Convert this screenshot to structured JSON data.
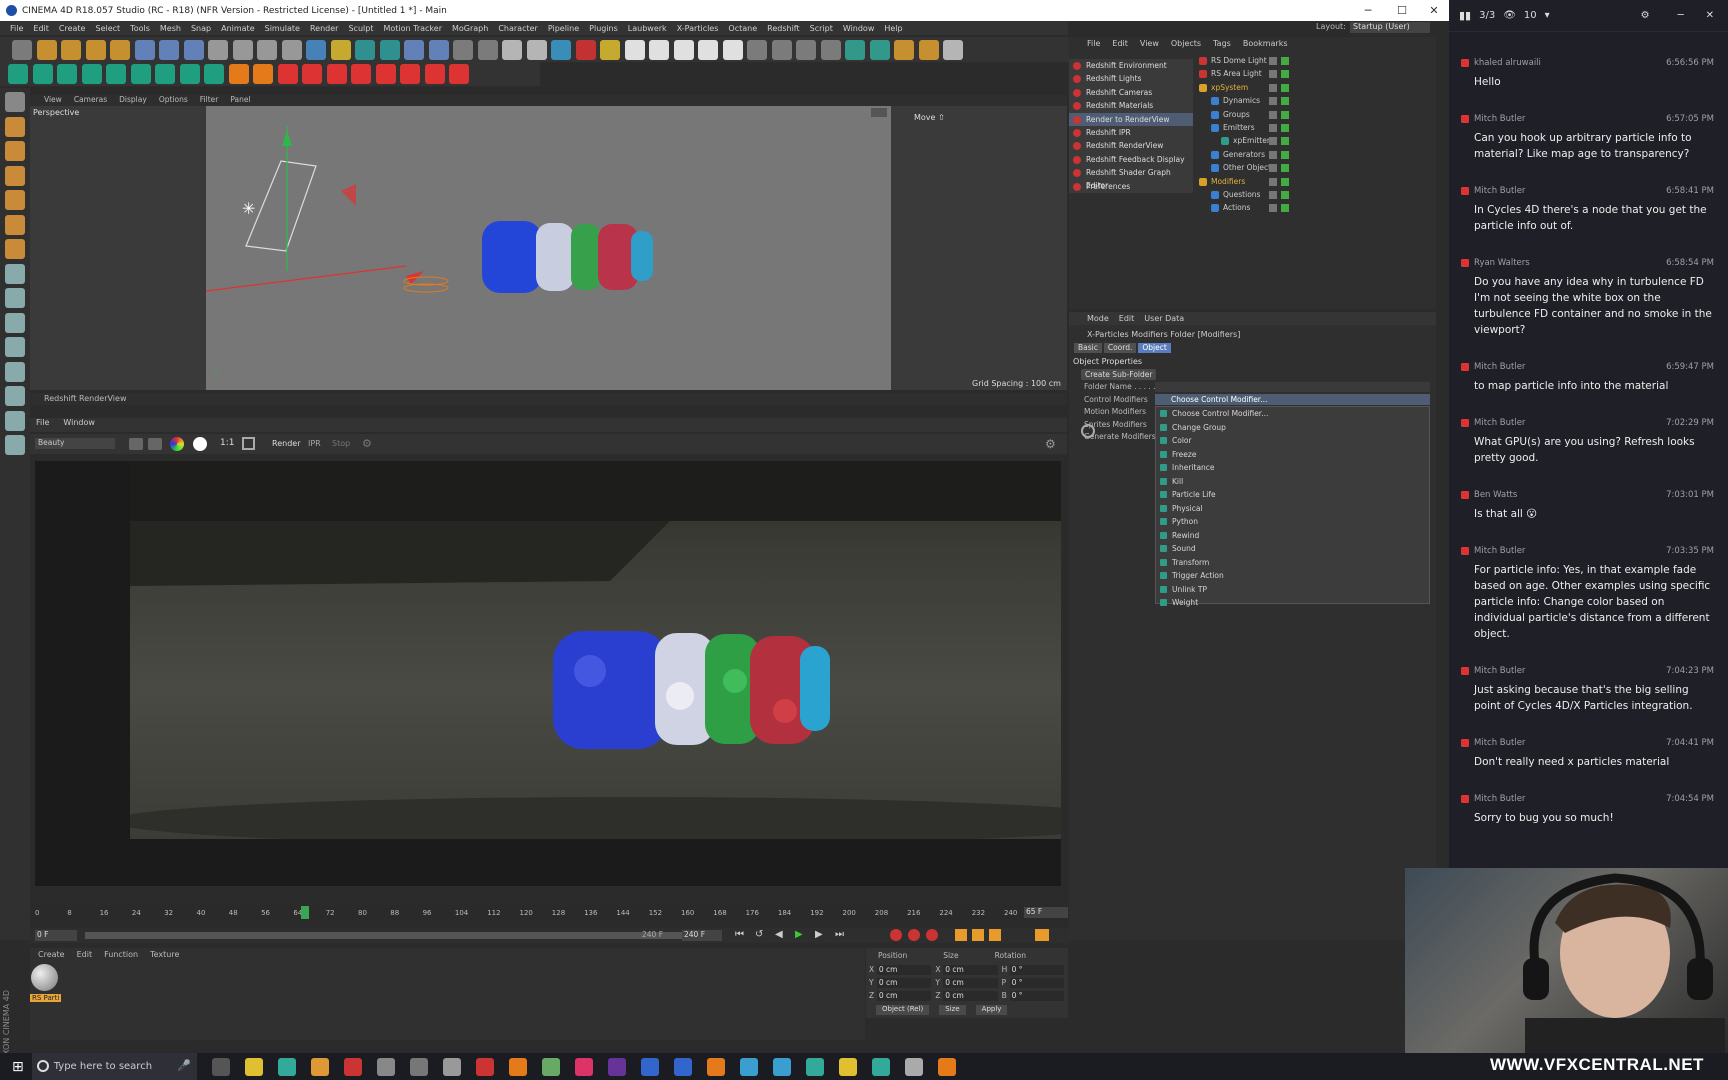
{
  "window": {
    "title": "CINEMA 4D R18.057 Studio (RC - R18) (NFR Version - Restricted License) - [Untitled 1 *] - Main"
  },
  "menubar": [
    "File",
    "Edit",
    "Create",
    "Select",
    "Tools",
    "Mesh",
    "Snap",
    "Animate",
    "Simulate",
    "Render",
    "Sculpt",
    "Motion Tracker",
    "MoGraph",
    "Character",
    "Pipeline",
    "Plugins",
    "Laubwerk",
    "X-Particles",
    "Octane",
    "Redshift",
    "Script",
    "Window",
    "Help"
  ],
  "layout": {
    "label": "Layout:",
    "value": "Startup (User)"
  },
  "viewport": {
    "menu": [
      "View",
      "Cameras",
      "Display",
      "Options",
      "Filter",
      "Panel"
    ],
    "name": "Perspective",
    "move_label": "Move ⇧",
    "grid_spacing": "Grid Spacing : 100 cm"
  },
  "renderview": {
    "title": "Redshift RenderView",
    "menu": [
      "File",
      "Window"
    ],
    "aov": "Beauty",
    "ratio": "1:1",
    "render": "Render",
    "ipr": "IPR",
    "stop": "Stop"
  },
  "timeline": {
    "ticks": [
      "0",
      "8",
      "16",
      "24",
      "32",
      "40",
      "48",
      "56",
      "64",
      "72",
      "80",
      "88",
      "96",
      "104",
      "112",
      "120",
      "128",
      "136",
      "144",
      "152",
      "160",
      "168",
      "176",
      "184",
      "192",
      "200",
      "208",
      "216",
      "224",
      "232",
      "240"
    ],
    "current": "65 F",
    "start": "0 F",
    "end": "240 F",
    "end2": "240 F"
  },
  "material": {
    "menu": [
      "Create",
      "Edit",
      "Function",
      "Texture"
    ],
    "item": "RS Parti"
  },
  "coords": {
    "headers": [
      "Position",
      "Size",
      "Rotation"
    ],
    "rows": [
      [
        "X",
        "0 cm",
        "X",
        "0 cm",
        "H",
        "0 °"
      ],
      [
        "Y",
        "0 cm",
        "Y",
        "0 cm",
        "P",
        "0 °"
      ],
      [
        "Z",
        "0 cm",
        "Z",
        "0 cm",
        "B",
        "0 °"
      ]
    ],
    "mode": "Object (Rel)",
    "size_mode": "Size",
    "apply": "Apply"
  },
  "right_menu": [
    "File",
    "Edit",
    "View",
    "Objects",
    "Tags",
    "Bookmarks"
  ],
  "redshift_menu": [
    "Redshift Environment",
    "Redshift Lights",
    "Redshift Cameras",
    "Redshift Materials",
    "Render to RenderView",
    "Redshift IPR",
    "Redshift RenderView",
    "Redshift Feedback Display",
    "Redshift Shader Graph Editor",
    "Preferences"
  ],
  "objects": [
    {
      "name": "RS Dome Light",
      "color": "#c33"
    },
    {
      "name": "RS Area Light",
      "color": "#c33"
    },
    {
      "name": "xpSystem",
      "color": "#d9a12a"
    },
    {
      "name": "Dynamics",
      "color": "#3b7fd1"
    },
    {
      "name": "Groups",
      "color": "#3b7fd1"
    },
    {
      "name": "Emitters",
      "color": "#3b7fd1"
    },
    {
      "name": "xpEmitter",
      "color": "#2f9c8a"
    },
    {
      "name": "Generators",
      "color": "#3b7fd1"
    },
    {
      "name": "Other Objects",
      "color": "#3b7fd1"
    },
    {
      "name": "Modifiers",
      "color": "#d9a12a"
    },
    {
      "name": "Questions",
      "color": "#3b7fd1"
    },
    {
      "name": "Actions",
      "color": "#3b7fd1"
    }
  ],
  "attributes": {
    "menu": [
      "Mode",
      "Edit",
      "User Data"
    ],
    "title": "X-Particles Modifiers Folder [Modifiers]",
    "tabs": [
      "Basic",
      "Coord.",
      "Object"
    ],
    "section": "Object Properties",
    "create_btn": "Create Sub-Folder",
    "fields": [
      "Folder Name . . . . .",
      "Control Modifiers",
      "Motion Modifiers",
      "Sprites Modifiers",
      "Generate Modifiers"
    ],
    "select_value": "Choose Control Modifier...",
    "options": [
      "Choose Control Modifier...",
      "Change Group",
      "Color",
      "Freeze",
      "Inheritance",
      "Kill",
      "Particle Life",
      "Physical",
      "Python",
      "Rewind",
      "Sound",
      "Transform",
      "Trigger Action",
      "Unlink TP",
      "Weight"
    ]
  },
  "chat": {
    "counter": "3/3",
    "viewers": "10",
    "messages": [
      {
        "user": "khaled alruwaili",
        "time": "6:56:56 PM",
        "text": "Hello"
      },
      {
        "user": "Mitch Butler",
        "time": "6:57:05 PM",
        "text": "Can you hook up arbitrary particle info to material? Like map age to transparency?"
      },
      {
        "user": "Mitch Butler",
        "time": "6:58:41 PM",
        "text": "In Cycles 4D there's a node that you get the particle info out of."
      },
      {
        "user": "Ryan Walters",
        "time": "6:58:54 PM",
        "text": "Do you have any idea why in turbulence FD I'm not seeing the white box on the turbulence FD container and no smoke in the viewport?"
      },
      {
        "user": "Mitch Butler",
        "time": "6:59:47 PM",
        "text": "to map particle info into the material"
      },
      {
        "user": "Mitch Butler",
        "time": "7:02:29 PM",
        "text": "What GPU(s) are you using? Refresh looks pretty good."
      },
      {
        "user": "Ben Watts",
        "time": "7:03:01 PM",
        "text": "Is that all 😮"
      },
      {
        "user": "Mitch Butler",
        "time": "7:03:35 PM",
        "text": "For particle info: Yes, in that example fade based on age. Other examples using specific particle info: Change color based on individual particle's distance from a different object."
      },
      {
        "user": "Mitch Butler",
        "time": "7:04:23 PM",
        "text": "Just asking because that's the big selling point of Cycles 4D/X Particles integration."
      },
      {
        "user": "Mitch Butler",
        "time": "7:04:41 PM",
        "text": "Don't really need x particles material"
      },
      {
        "user": "Mitch Butler",
        "time": "7:04:54 PM",
        "text": "Sorry to bug you so much!"
      }
    ]
  },
  "taskbar": {
    "search_placeholder": "Type here to search"
  },
  "watermark": "WWW.VFXCENTRAL.NET",
  "side_label": "MAXON CINEMA 4D"
}
